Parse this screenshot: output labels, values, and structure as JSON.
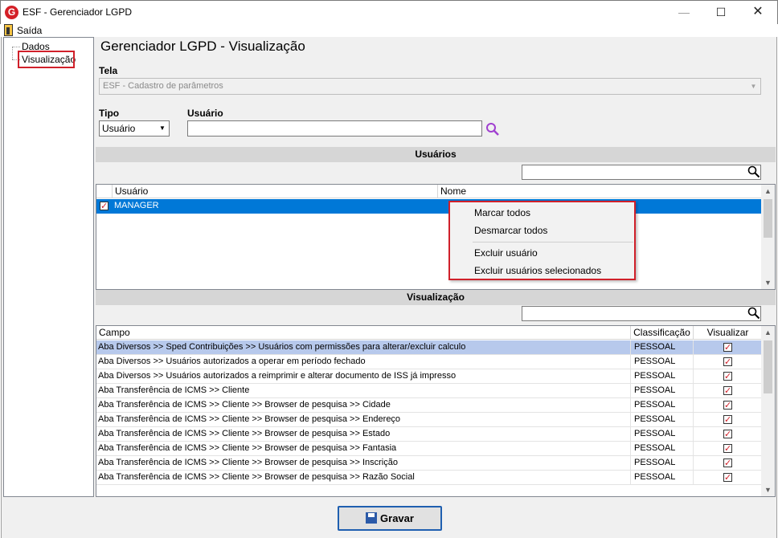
{
  "window": {
    "title": "ESF - Gerenciador LGPD",
    "app_icon": "G",
    "min": "—",
    "max": "☐",
    "close": "✕"
  },
  "menu": {
    "exit_label": "Saída"
  },
  "tree": {
    "items": [
      {
        "label": "Dados"
      },
      {
        "label": "Visualização"
      }
    ]
  },
  "page_title": "Gerenciador LGPD - Visualização",
  "tela": {
    "label": "Tela",
    "value": "ESF - Cadastro de parâmetros"
  },
  "tipo": {
    "label": "Tipo",
    "value": "Usuário"
  },
  "usuario": {
    "label": "Usuário",
    "value": ""
  },
  "usuarios_section": {
    "title": "Usuários",
    "columns": [
      "Usuário",
      "Nome"
    ],
    "rows": [
      {
        "checked": true,
        "usuario": "MANAGER",
        "nome": ""
      }
    ]
  },
  "context_menu": {
    "items": [
      "Marcar todos",
      "Desmarcar todos",
      "Excluir usuário",
      "Excluir usuários selecionados"
    ]
  },
  "visualizacao_section": {
    "title": "Visualização",
    "columns": [
      "Campo",
      "Classificação",
      "Visualizar"
    ],
    "rows": [
      {
        "campo": "Aba Diversos >> Sped Contribuições >> Usuários com permissões para alterar/excluir calculo",
        "classificacao": "PESSOAL",
        "visualizar": true
      },
      {
        "campo": "Aba Diversos >> Usuários autorizados a operar em período fechado",
        "classificacao": "PESSOAL",
        "visualizar": true
      },
      {
        "campo": "Aba Diversos >> Usuários autorizados a reimprimir e alterar documento de ISS já impresso",
        "classificacao": "PESSOAL",
        "visualizar": true
      },
      {
        "campo": "Aba Transferência de ICMS >> Cliente",
        "classificacao": "PESSOAL",
        "visualizar": true
      },
      {
        "campo": "Aba Transferência de ICMS >> Cliente >> Browser de pesquisa >> Cidade",
        "classificacao": "PESSOAL",
        "visualizar": true
      },
      {
        "campo": "Aba Transferência de ICMS >> Cliente >> Browser de pesquisa >> Endereço",
        "classificacao": "PESSOAL",
        "visualizar": true
      },
      {
        "campo": "Aba Transferência de ICMS >> Cliente >> Browser de pesquisa >> Estado",
        "classificacao": "PESSOAL",
        "visualizar": true
      },
      {
        "campo": "Aba Transferência de ICMS >> Cliente >> Browser de pesquisa >> Fantasia",
        "classificacao": "PESSOAL",
        "visualizar": true
      },
      {
        "campo": "Aba Transferência de ICMS >> Cliente >> Browser de pesquisa >> Inscrição",
        "classificacao": "PESSOAL",
        "visualizar": true
      },
      {
        "campo": "Aba Transferência de ICMS >> Cliente >> Browser de pesquisa >> Razão Social",
        "classificacao": "PESSOAL",
        "visualizar": true
      }
    ]
  },
  "gravar_label": "Gravar",
  "colors": {
    "accent": "#0078d7",
    "highlight_border": "#d0202a",
    "selected_row": "#b7c9ec"
  }
}
